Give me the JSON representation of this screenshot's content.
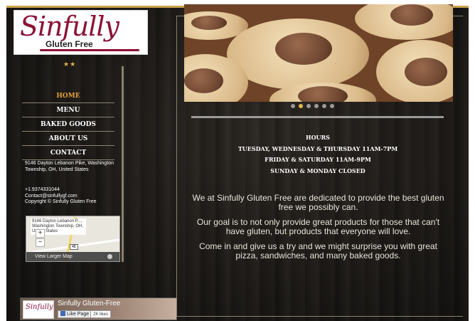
{
  "logo": {
    "script": "Sinfully",
    "subtitle": "Gluten Free",
    "stars": "★★"
  },
  "nav": {
    "items": [
      {
        "label": "HOME",
        "active": true
      },
      {
        "label": "MENU",
        "active": false
      },
      {
        "label": "BAKED GOODS",
        "active": false
      },
      {
        "label": "ABOUT US",
        "active": false
      },
      {
        "label": "CONTACT",
        "active": false
      }
    ]
  },
  "sidebar": {
    "address": "9146 Dayton Lebanon Pike, Washington Township, OH, United States",
    "phone": "+1.9374331044",
    "email": "Contact@sinfullygf.com",
    "copyright": "Copyright © Sinfully Gluten Free"
  },
  "map": {
    "info": "9146 Dayton Lebanon P..., Washington Township, OH, United States",
    "zoom_in": "+",
    "zoom_out": "−",
    "highway": "48",
    "larger_map": "View Larger Map"
  },
  "facebook": {
    "page_name": "Sinfully Gluten-Free",
    "thumb_text": "Sinfully",
    "like_label": "Like Page",
    "like_count": "2K likes"
  },
  "slider": {
    "dot_count": 6,
    "active_index": 1
  },
  "hours": {
    "heading": "HOURS",
    "line1": "TUESDAY, WEDNESDAY & THURSDAY 11AM-7PM",
    "line2": "FRIDAY & SATURDAY 11AM-9PM",
    "line3": "SUNDAY & MONDAY CLOSED"
  },
  "about": {
    "p1": "We at Sinfully Gluten Free are dedicated to provide the best gluten free we possibly can.",
    "p2": "Our goal is to not only provide great products for those that can't have gluten, but products that everyone will love.",
    "p3": "Come in and give us a try and we might surprise you with great pizza, sandwiches, and many baked goods."
  },
  "colors": {
    "accent_gold": "#e7b64a",
    "active_nav": "#e7a43c",
    "brand_wine": "#8b1236"
  }
}
